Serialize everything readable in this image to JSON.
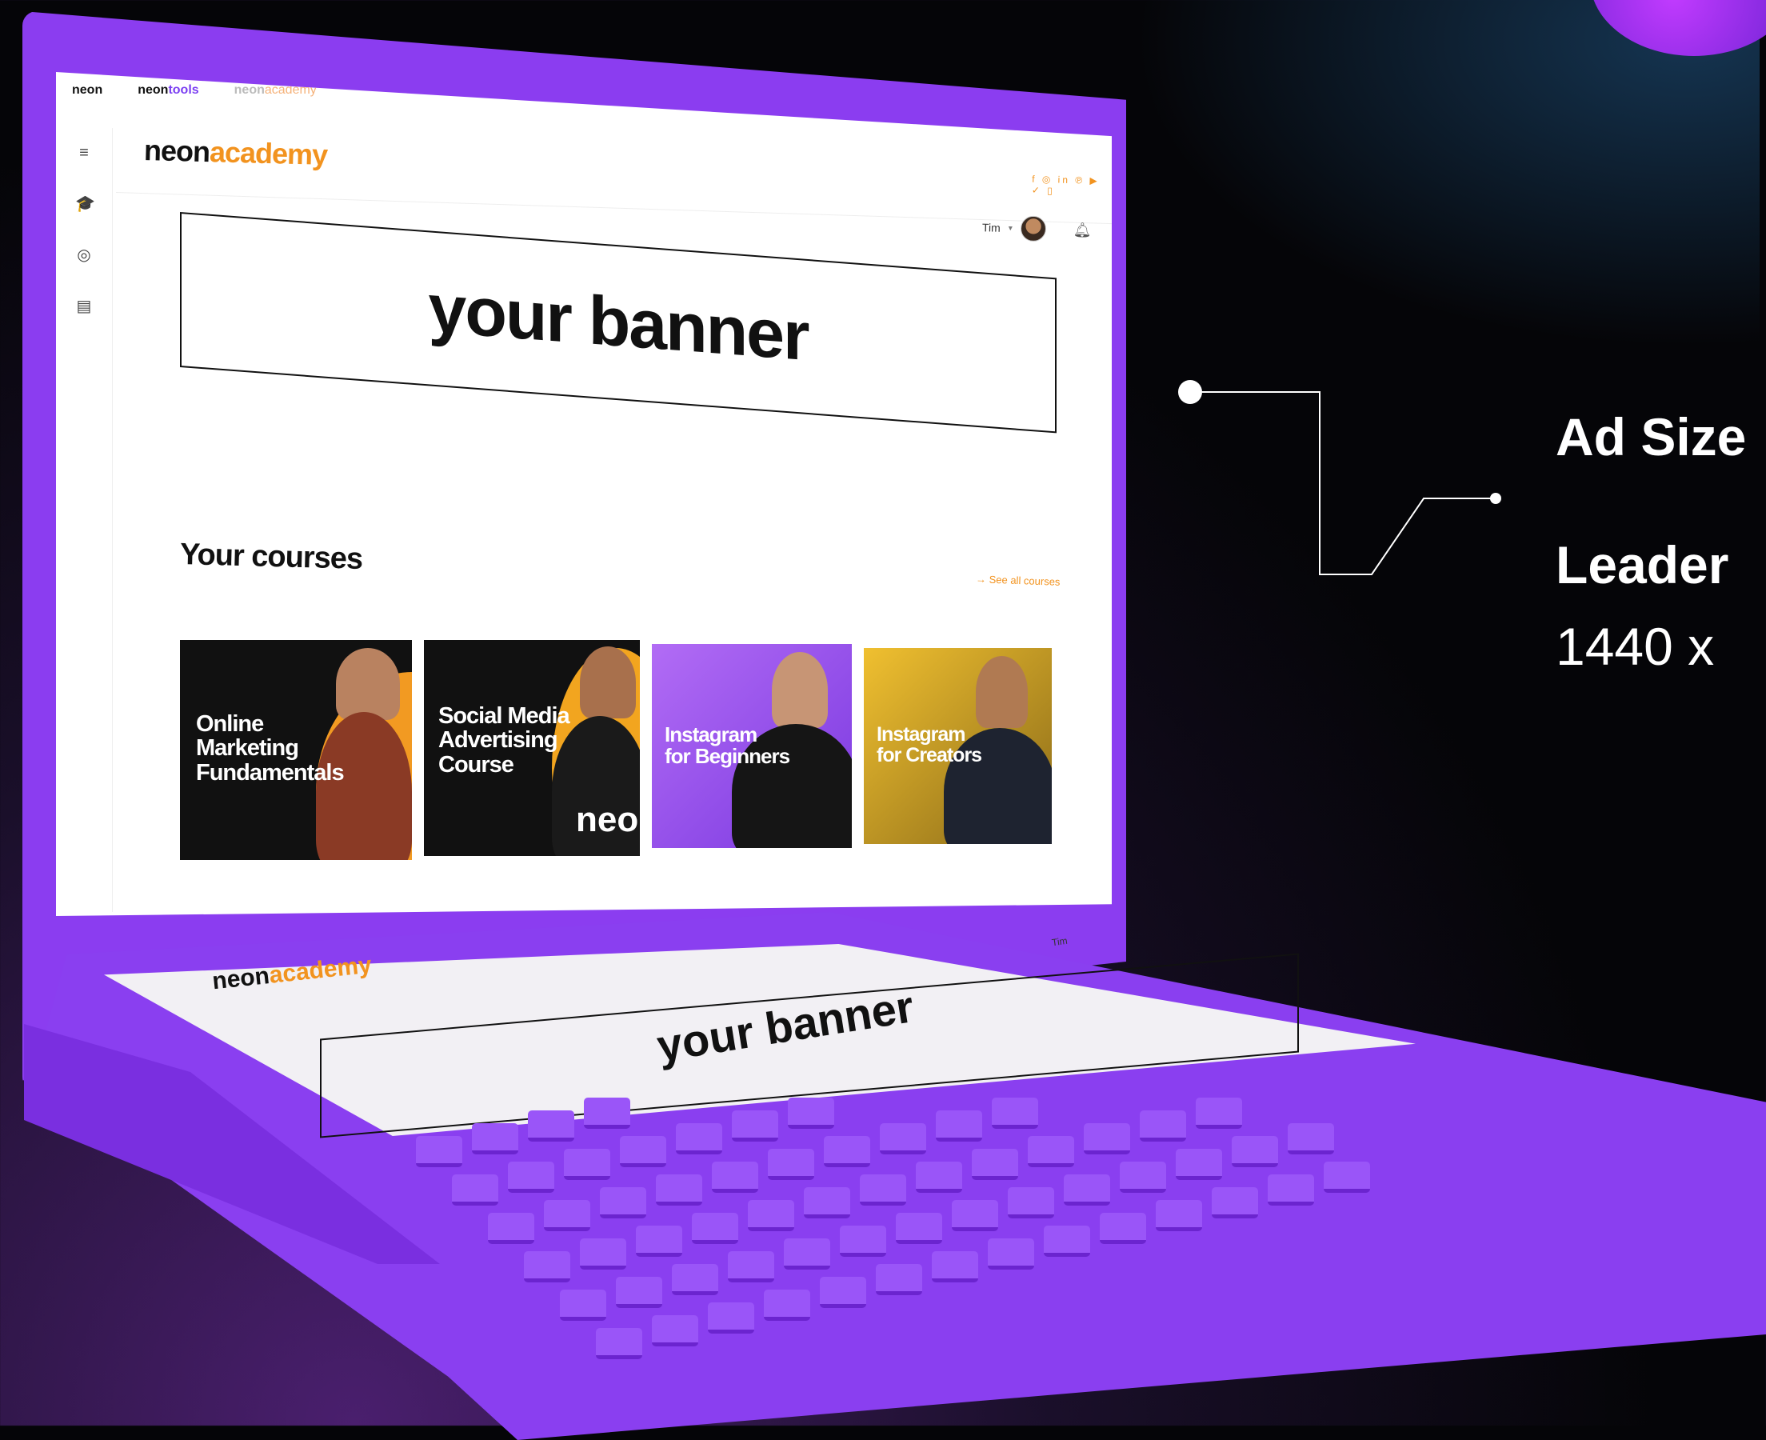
{
  "browser_tabs": {
    "neon": "neon",
    "tools_prefix": "neon",
    "tools_suffix": "tools",
    "academy_prefix": "neon",
    "academy_suffix": "academy"
  },
  "sidebar": {
    "items": [
      {
        "icon": "menu-icon",
        "glyph": "≡"
      },
      {
        "icon": "graduation-cap-icon",
        "glyph": "🎓"
      },
      {
        "icon": "chat-icon",
        "glyph": "◎"
      },
      {
        "icon": "certificate-icon",
        "glyph": "▤"
      }
    ]
  },
  "header": {
    "logo_prefix": "neon",
    "logo_suffix": "academy",
    "social_icons": "f ◎ in ℗ ▶ ✓ ▯",
    "user_name": "Tim"
  },
  "banner": {
    "text": "your banner"
  },
  "courses": {
    "title": "Your courses",
    "see_all": "→  See all courses",
    "items": [
      {
        "line1": "Online",
        "line2": "Marketing",
        "line3": "Fundamentals",
        "bg": "#111111",
        "accent": "#f29a22"
      },
      {
        "line1": "Social Media",
        "line2": "Advertising",
        "line3": "Course",
        "bg": "#111111",
        "accent": "#f2a51f"
      },
      {
        "line1": "Instagram",
        "line2": "for Beginners",
        "line3": "",
        "bg": "#8a44e8",
        "accent": "#a060f5"
      },
      {
        "line1": "Instagram",
        "line2": "for Creators",
        "line3": "",
        "bg": "#d9a81f",
        "accent": "#e8b830"
      }
    ],
    "card2_mark": "neo"
  },
  "deck": {
    "logo_prefix": "neon",
    "logo_suffix": "academy",
    "banner_text": "your banner",
    "user_name": "Tim"
  },
  "callout": {
    "label": "Ad Size",
    "name": "Leader",
    "dimensions": "1440 x"
  },
  "colors": {
    "laptop": "#8b3df0",
    "accent_orange": "#f2931f",
    "brand_purple": "#7b3ff2"
  }
}
